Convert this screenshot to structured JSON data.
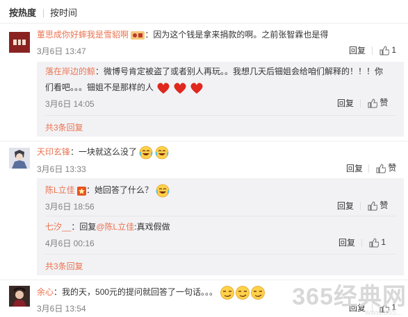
{
  "sort": {
    "hot": "按热度",
    "time": "按时间"
  },
  "comments": [
    {
      "name": "董思成你好蟀我是雪貂啊",
      "text": "：因为这个钱是拿来捐款的啊。之前张智霖也是得",
      "time": "3月6日 13:47",
      "reply_label": "回复",
      "like_count": "1",
      "replies": [
        {
          "name": "落在岸边的鲸",
          "text_line1": "：微博号肯定被盗了或者别人再玩。。我想几天后钿姐会给咱们解释的！！！你",
          "text_line2": "们看吧。。。钿姐不是那样的人",
          "time": "3月6日 14:05",
          "reply_label": "回复",
          "like_label": "赞"
        }
      ],
      "more": "共3条回复"
    },
    {
      "name": "天印玄锋",
      "text": "：一块就这么没了",
      "time": "3月6日 13:33",
      "reply_label": "回复",
      "like_label": "赞",
      "replies": [
        {
          "name": "陈L立佳",
          "text": "：她回答了什么？",
          "time": "3月6日 18:56",
          "reply_label": "回复",
          "like_label": "赞"
        },
        {
          "name": "七汐__",
          "text_pre": "：回复",
          "mention": "@陈L立佳",
          "text_post": ":真戏假做",
          "time": "4月6日 00:16",
          "reply_label": "回复",
          "like_count": "1"
        }
      ],
      "more": "共3条回复"
    },
    {
      "name": "余心",
      "text": "：我的天，500元的提问就回答了一句话。。。",
      "time": "3月6日 13:54",
      "reply_label": "回复",
      "like_count": "1"
    }
  ],
  "watermark": {
    "main": "365经典网",
    "sub": "www.365..."
  },
  "colors": {
    "name": "#eb7350",
    "reply_bg": "#f2f2f5",
    "time": "#808080"
  }
}
